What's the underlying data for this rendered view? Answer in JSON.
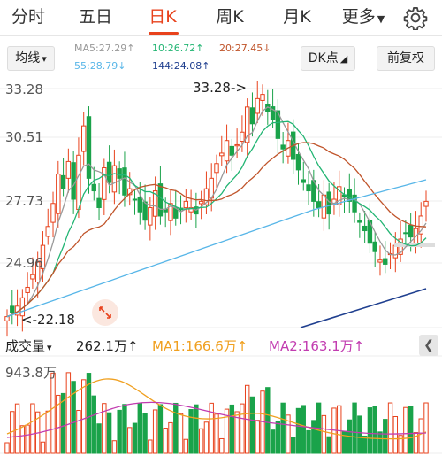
{
  "tabs": [
    {
      "label": "分时",
      "active": false
    },
    {
      "label": "五日",
      "active": false
    },
    {
      "label": "日K",
      "active": true
    },
    {
      "label": "周K",
      "active": false
    },
    {
      "label": "月K",
      "active": false
    },
    {
      "label": "更多",
      "active": false
    }
  ],
  "toolbar": {
    "adjust_label": "均线",
    "dk_label": "DK点",
    "fq_label": "前复权"
  },
  "ma": {
    "ma5": "MA5:27.29↑",
    "ma10": "10:26.72↑",
    "ma20": "20:27.45↓",
    "ma55": "55:28.79↓",
    "ma144": "144:24.08↑"
  },
  "price_axis": [
    "33.28",
    "30.51",
    "27.73",
    "24.96"
  ],
  "annotations": {
    "high": "33.28->",
    "low": "<-22.18"
  },
  "volume": {
    "title": "成交量",
    "value": "262.1万↑",
    "ma1": "MA1:166.6万↑",
    "ma2": "MA2:163.1万↑",
    "axis_max": "943.8万"
  },
  "colors": {
    "up": "#e8421c",
    "down": "#1aa34a",
    "ma5": "#999999",
    "ma10": "#22b573",
    "ma20": "#c0542a",
    "ma55": "#58b6e8",
    "ma144": "#1f3f8f",
    "vma1": "#f0a020",
    "vma2": "#c23cb0"
  }
}
